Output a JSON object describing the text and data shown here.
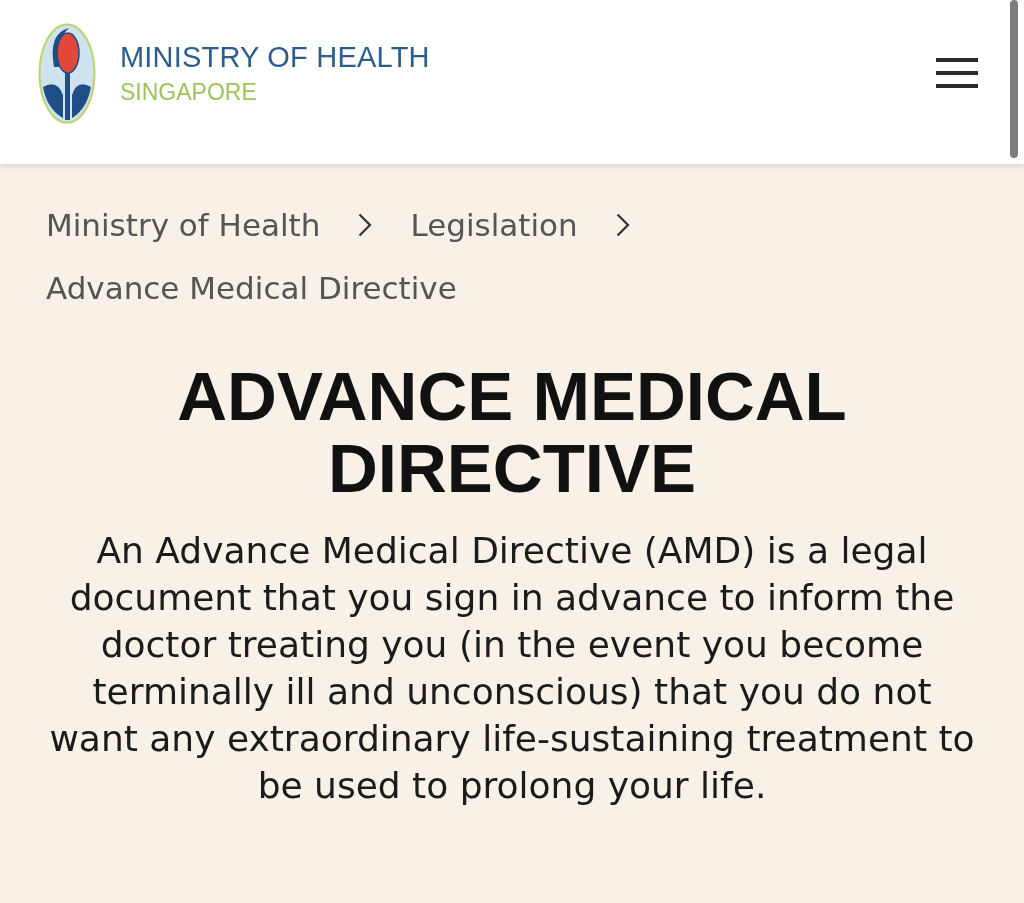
{
  "header": {
    "logo_title": "MINISTRY OF HEALTH",
    "logo_subtitle": "SINGAPORE"
  },
  "breadcrumb": [
    {
      "label": "Ministry of Health"
    },
    {
      "label": "Legislation"
    },
    {
      "label": "Advance Medical Directive"
    }
  ],
  "article": {
    "title": "ADVANCE MEDICAL DIRECTIVE",
    "intro": "An Advance Medical Directive (AMD) is a legal document that you sign in advance to inform the doctor treating you (in the event you become terminally ill and unconscious) that you do not want any extraordinary life-sustaining treatment to be used to prolong your life."
  }
}
